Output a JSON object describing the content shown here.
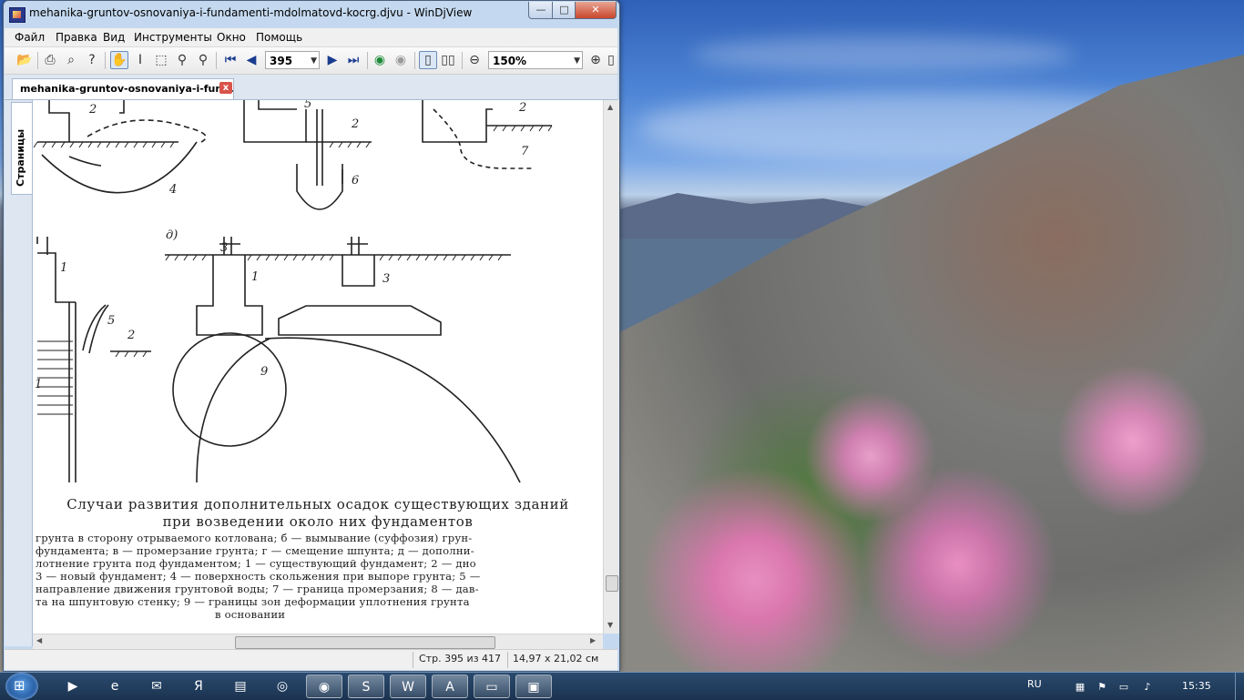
{
  "window": {
    "title": "mehanika-gruntov-osnovaniya-i-fundamenti-mdolmatovd-kocrg.djvu - WinDjView",
    "btn_min": "—",
    "btn_max": "□",
    "btn_close": "✕"
  },
  "menu": [
    "Файл",
    "Правка",
    "Вид",
    "Инструменты",
    "Окно",
    "Помощь"
  ],
  "toolbar": {
    "icons": [
      "open-icon",
      "print-icon",
      "find-icon",
      "help-icon",
      "hand-icon",
      "text-select-icon",
      "rect-select-icon",
      "zoom-icon",
      "zoom-rect-icon",
      "first-page-icon",
      "prev-page-icon",
      "next-page-icon",
      "last-page-icon",
      "back-icon",
      "forward-icon",
      "single-page-icon",
      "two-pages-icon",
      "zoom-out-icon",
      "zoom-in-icon"
    ],
    "page_value": "395",
    "zoom_value": "150%"
  },
  "tab": {
    "label": "mehanika-gruntov-osnovaniya-i-fun...",
    "close": "x"
  },
  "side_tab": "Страницы",
  "page": {
    "fig_label_d": "д)",
    "fig_numbers": [
      "2",
      "4",
      "5",
      "2",
      "6",
      "2",
      "7",
      "1",
      "5",
      "2",
      "3",
      "1",
      "1",
      "3",
      "9"
    ],
    "caption_title_1": "Случаи развития дополнительных осадок существующих зданий",
    "caption_title_2": "при возведении около них фундаментов",
    "caption_lines": [
      "грунта в сторону отрываемого котлована; б — вымывание (суффозия) грун-",
      "фундамента; в — промерзание грунта; г — смещение шпунта; д — дополни-",
      "лотнение грунта под фундаментом; 1 — существующий фундамент; 2 — дно",
      "3 — новый фундамент; 4 — поверхность скольжения при выпоре грунта; 5 —",
      "направление движения грунтовой воды; 7 — граница промерзания; 8 — дав-",
      "та на шпунтовую стенку; 9 — границы зон деформации уплотнения грунта",
      "в основании"
    ]
  },
  "status": {
    "page": "Стр. 395 из 417",
    "size": "14,97 x 21,02 см"
  },
  "taskbar": {
    "apps": [
      "media-player-icon",
      "ie-icon",
      "mail-icon",
      "yandex-icon",
      "explorer-icon",
      "app-icon",
      "chrome-icon",
      "skype-icon",
      "word-icon",
      "acrobat-icon",
      "window-icon",
      "windjview-icon"
    ],
    "lang": "RU",
    "clock": "15:35"
  }
}
